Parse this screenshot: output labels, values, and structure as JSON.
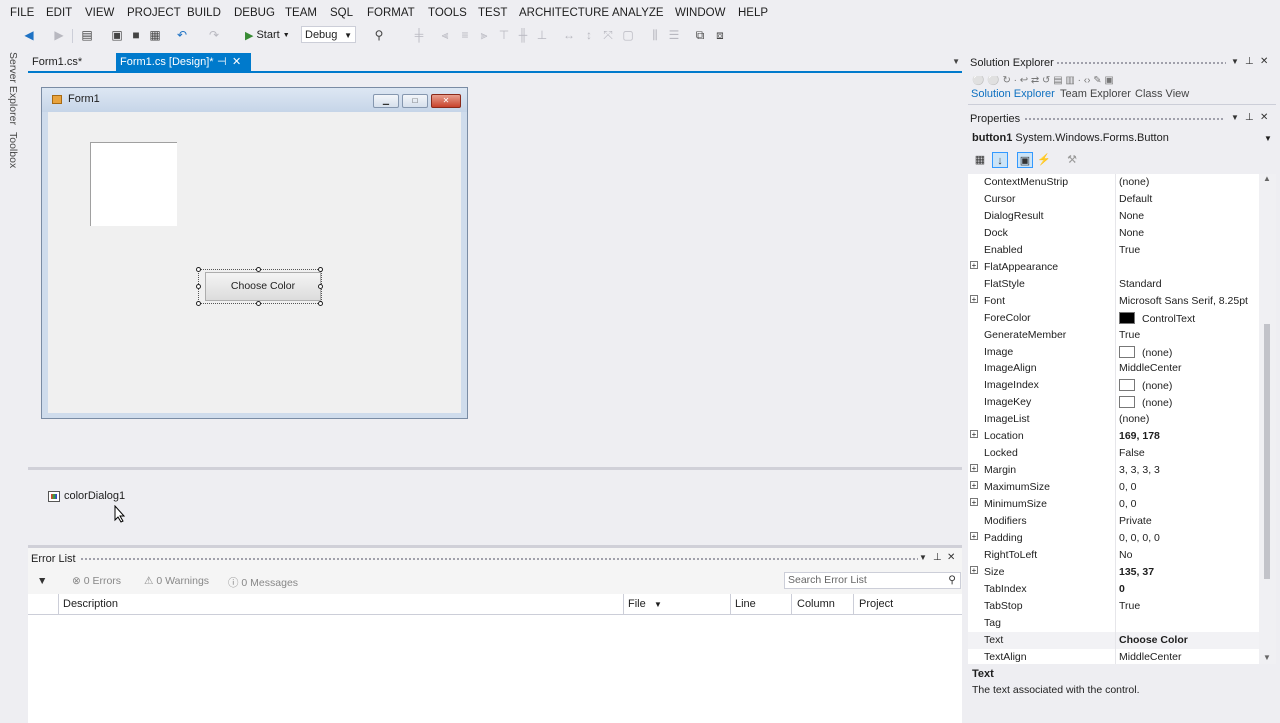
{
  "menu": [
    "FILE",
    "EDIT",
    "VIEW",
    "PROJECT",
    "BUILD",
    "DEBUG",
    "TEAM",
    "SQL",
    "FORMAT",
    "TOOLS",
    "TEST",
    "ARCHITECTURE",
    "ANALYZE",
    "WINDOW",
    "HELP"
  ],
  "toolbar": {
    "start_label": "Start",
    "config": "Debug"
  },
  "left_rail": [
    "Server Explorer",
    "Toolbox"
  ],
  "doc_tabs": [
    {
      "label": "Form1.cs*"
    },
    {
      "label": "Form1.cs [Design]*",
      "pin": "⊣",
      "close": "✕"
    }
  ],
  "form": {
    "title": "Form1",
    "button_text": "Choose Color"
  },
  "tray": {
    "component": "colorDialog1"
  },
  "error_list": {
    "title": "Error List",
    "errors": "0 Errors",
    "warnings": "0 Warnings",
    "messages": "0 Messages",
    "search_placeholder": "Search Error List",
    "columns": [
      "Description",
      "File",
      "Line",
      "Column",
      "Project"
    ]
  },
  "solution_explorer": {
    "title": "Solution Explorer",
    "tabs": [
      "Solution Explorer",
      "Team Explorer",
      "Class View"
    ]
  },
  "properties": {
    "title": "Properties",
    "object_name": "button1",
    "object_type": "System.Windows.Forms.Button",
    "rows": [
      {
        "name": "ContextMenuStrip",
        "value": "(none)"
      },
      {
        "name": "Cursor",
        "value": "Default"
      },
      {
        "name": "DialogResult",
        "value": "None"
      },
      {
        "name": "Dock",
        "value": "None"
      },
      {
        "name": "Enabled",
        "value": "True"
      },
      {
        "name": "FlatAppearance",
        "value": "",
        "expandable": true
      },
      {
        "name": "FlatStyle",
        "value": "Standard"
      },
      {
        "name": "Font",
        "value": "Microsoft Sans Serif, 8.25pt",
        "expandable": true
      },
      {
        "name": "ForeColor",
        "value": "ControlText",
        "swatch": "#000000"
      },
      {
        "name": "GenerateMember",
        "value": "True"
      },
      {
        "name": "Image",
        "value": "(none)",
        "swatch": "#ffffff"
      },
      {
        "name": "ImageAlign",
        "value": "MiddleCenter"
      },
      {
        "name": "ImageIndex",
        "value": "(none)",
        "swatch": "#ffffff"
      },
      {
        "name": "ImageKey",
        "value": "(none)",
        "swatch": "#ffffff"
      },
      {
        "name": "ImageList",
        "value": "(none)"
      },
      {
        "name": "Location",
        "value": "169, 178",
        "expandable": true,
        "bold": true
      },
      {
        "name": "Locked",
        "value": "False"
      },
      {
        "name": "Margin",
        "value": "3, 3, 3, 3",
        "expandable": true
      },
      {
        "name": "MaximumSize",
        "value": "0, 0",
        "expandable": true
      },
      {
        "name": "MinimumSize",
        "value": "0, 0",
        "expandable": true
      },
      {
        "name": "Modifiers",
        "value": "Private"
      },
      {
        "name": "Padding",
        "value": "0, 0, 0, 0",
        "expandable": true
      },
      {
        "name": "RightToLeft",
        "value": "No"
      },
      {
        "name": "Size",
        "value": "135, 37",
        "expandable": true,
        "bold": true
      },
      {
        "name": "TabIndex",
        "value": "0",
        "bold": true
      },
      {
        "name": "TabStop",
        "value": "True"
      },
      {
        "name": "Tag",
        "value": ""
      },
      {
        "name": "Text",
        "value": "Choose Color",
        "bold": true,
        "selected": true
      },
      {
        "name": "TextAlign",
        "value": "MiddleCenter"
      }
    ],
    "description_title": "Text",
    "description_text": "The text associated with the control."
  },
  "colors": {
    "accent": "#007acc",
    "chrome": "#eeeef2"
  }
}
